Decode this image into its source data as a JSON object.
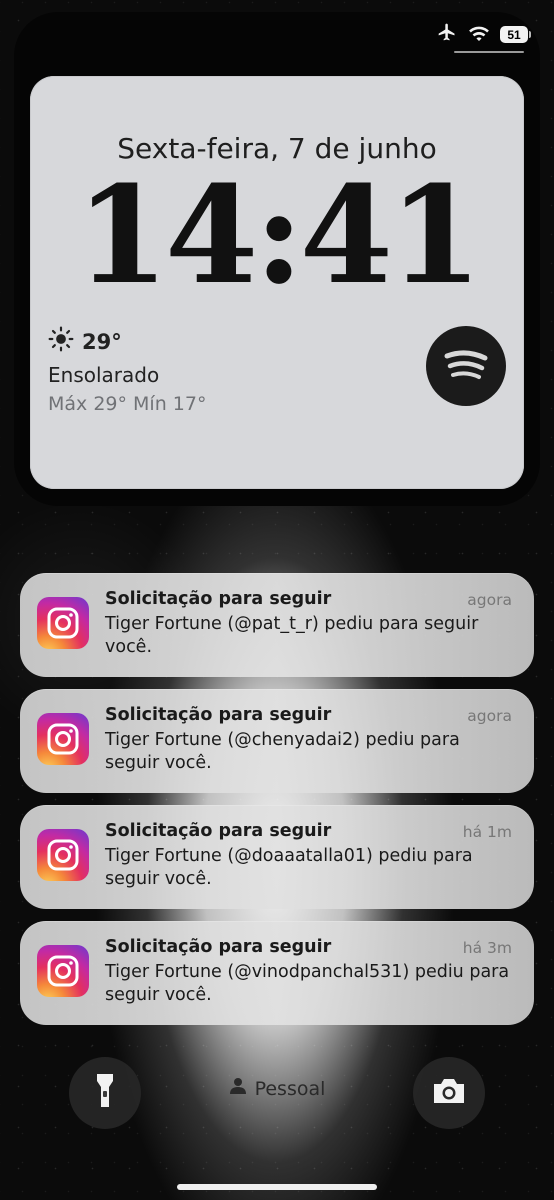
{
  "status_bar": {
    "icons": [
      "airplane-icon",
      "wifi-icon"
    ],
    "battery": "51"
  },
  "widget": {
    "date": "Sexta-feira, 7 de junho",
    "time": "14:41",
    "weather": {
      "icon": "sun-icon",
      "temp": "29°",
      "condition": "Ensolarado",
      "range": "Máx 29° Mín 17°"
    },
    "media_icon": "spotify-icon"
  },
  "notifications": [
    {
      "app_icon": "instagram-icon",
      "title": "Solicitação para seguir",
      "time": "agora",
      "body": "Tiger Fortune (@pat_t_r) pediu para seguir você."
    },
    {
      "app_icon": "instagram-icon",
      "title": "Solicitação para seguir",
      "time": "agora",
      "body": "Tiger Fortune (@chenyadai2) pediu para seguir você."
    },
    {
      "app_icon": "instagram-icon",
      "title": "Solicitação para seguir",
      "time": "há 1m",
      "body": "Tiger Fortune (@doaaatalla01) pediu para seguir você."
    },
    {
      "app_icon": "instagram-icon",
      "title": "Solicitação para seguir",
      "time": "há 3m",
      "body": "Tiger Fortune (@vinodpanchal531) pediu para seguir você."
    }
  ],
  "bottom": {
    "left_icon": "flashlight-icon",
    "focus_icon": "person-icon",
    "focus_label": "Pessoal",
    "right_icon": "camera-icon"
  },
  "colors": {
    "widget_bg": "#d7d8db",
    "spotify_bg": "#1b1b1b"
  }
}
